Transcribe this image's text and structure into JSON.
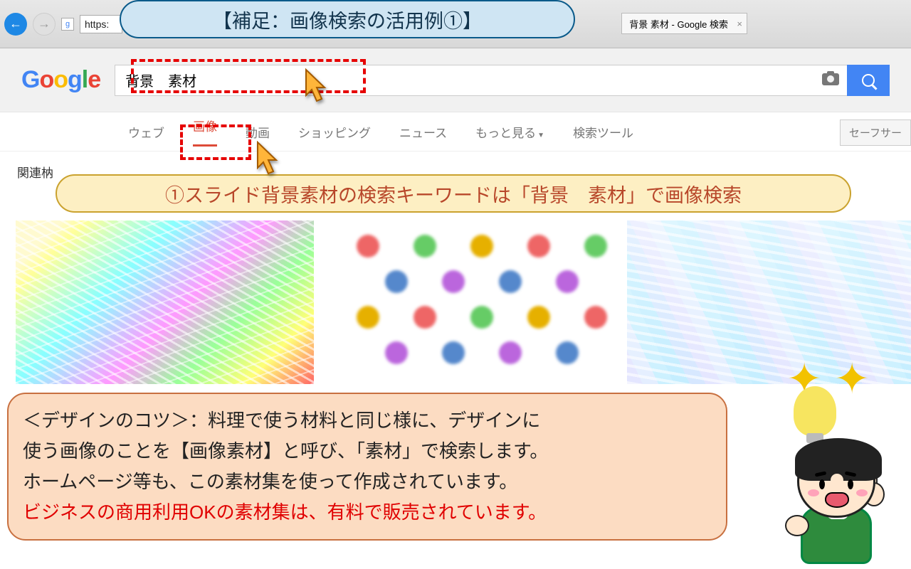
{
  "browser": {
    "url_preview": "https:",
    "tab_title": "背景 素材  - Google 検索",
    "tab_close": "×"
  },
  "logo": {
    "g1": "G",
    "g2": "o",
    "g3": "o",
    "g4": "g",
    "g5": "l",
    "g6": "e"
  },
  "search": {
    "query": "背景　素材"
  },
  "nav": {
    "web": "ウェブ",
    "images": "画像",
    "videos": "動画",
    "shopping": "ショッピング",
    "news": "ニュース",
    "more": "もっと見る",
    "tools": "検索ツール",
    "safe": "セーフサー"
  },
  "related_label": "関連枘",
  "annotations": {
    "top": "【補足：画像検索の活用例①】",
    "yellow": "①スライド背景素材の検索キーワードは「背景　素材」で画像検索",
    "orange_line1": "＜デザインのコツ＞：料理で使う材料と同じ様に、デザインに",
    "orange_line2": "使う画像のことを【画像素材】と呼び、「素材」で検索します。",
    "orange_line3": "ホームページ等も、この素材集を使って作成されています。",
    "orange_line4": "ビジネスの商用利用OKの素材集は、有料で販売されています。"
  }
}
